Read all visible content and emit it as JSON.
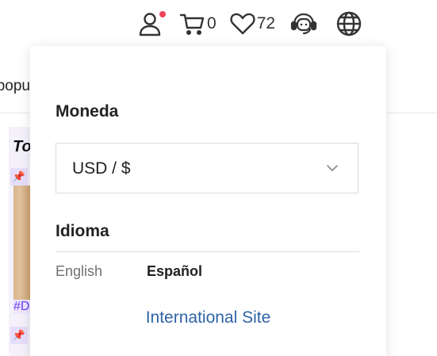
{
  "header": {
    "account": {
      "icon": "user-icon",
      "notification_color": "#f0455c"
    },
    "cart": {
      "icon": "cart-icon",
      "count": "0"
    },
    "wishlist": {
      "icon": "heart-icon",
      "count": "72"
    },
    "support": {
      "icon": "support-agent-icon"
    },
    "region": {
      "icon": "globe-icon"
    }
  },
  "background": {
    "nav_text": "popu",
    "card_title": "To",
    "card_tag": "#D"
  },
  "dropdown": {
    "currency": {
      "title": "Moneda",
      "selected": "USD / $"
    },
    "language": {
      "title": "Idioma",
      "options": [
        {
          "label": "English",
          "active": false
        },
        {
          "label": "Español",
          "active": true
        }
      ]
    },
    "international_link": "International Site",
    "link_color": "#2f63a8"
  }
}
